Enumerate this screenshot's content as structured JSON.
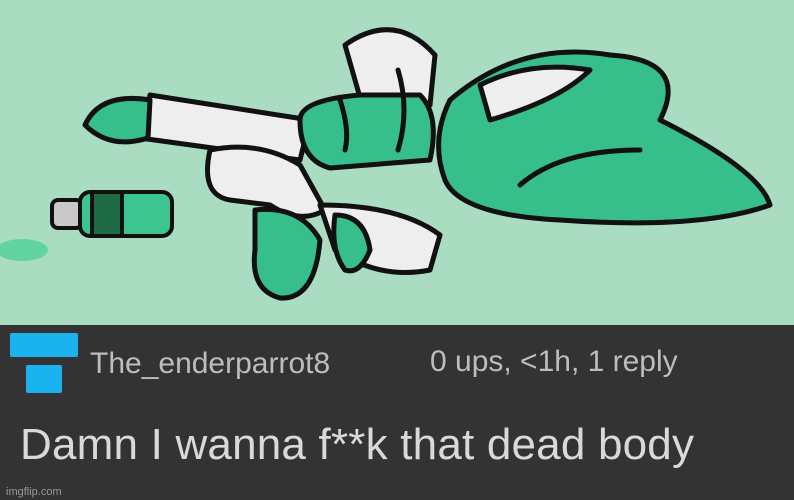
{
  "image": {
    "description_icon": "cartoon-illustration",
    "background_color": "#a9dcc0",
    "accent_color": "#33c08c"
  },
  "comment": {
    "username": "The_enderparrot8",
    "meta": "0 ups, <1h, 1 reply",
    "text": "Damn I wanna f**k that dead body",
    "avatar_color": "#1ab3f0"
  },
  "watermark": "imgflip.com"
}
